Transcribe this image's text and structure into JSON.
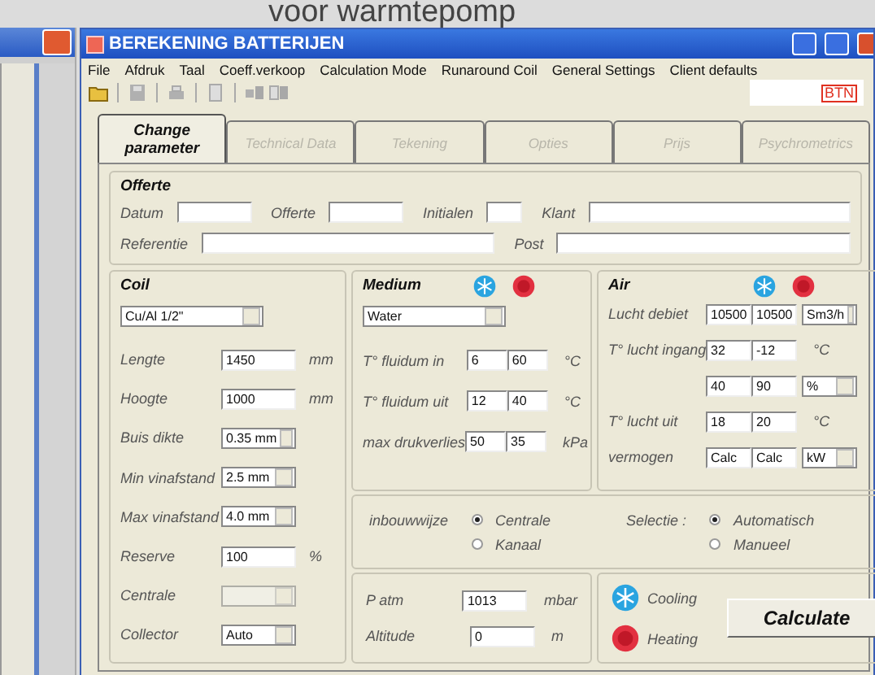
{
  "heading": "voor warmtepomp",
  "window": {
    "title": "BEREKENING BATTERIJEN",
    "logo": "BTN"
  },
  "menu": [
    "File",
    "Afdruk",
    "Taal",
    "Coeff.verkoop",
    "Calculation Mode",
    "Runaround Coil",
    "General Settings",
    "Client defaults"
  ],
  "tabs": [
    {
      "label": "Change parameter",
      "selected": true
    },
    {
      "label": "Technical Data",
      "selected": false
    },
    {
      "label": "Tekening",
      "selected": false
    },
    {
      "label": "Opties",
      "selected": false
    },
    {
      "label": "Prijs",
      "selected": false
    },
    {
      "label": "Psychrometrics",
      "selected": false
    }
  ],
  "offerte": {
    "title": "Offerte",
    "rows": [
      [
        {
          "label": "Datum"
        },
        {
          "label": "Offerte"
        },
        {
          "label": "Initialen"
        },
        {
          "label": "Klant"
        }
      ],
      [
        {
          "label": "Referentie"
        },
        {
          "label": "Post"
        }
      ]
    ]
  },
  "coil": {
    "title": "Coil",
    "type": "Cu/Al 1/2\"",
    "rows": [
      {
        "label": "Lengte",
        "kind": "input",
        "value": "1450",
        "unit": "mm",
        "disabled": false
      },
      {
        "label": "Hoogte",
        "kind": "input",
        "value": "1000",
        "unit": "mm",
        "disabled": false
      },
      {
        "label": "Buis dikte",
        "kind": "select",
        "value": "0.35 mm",
        "disabled": false
      },
      {
        "label": "Min vinafstand",
        "kind": "select",
        "value": "2.5 mm",
        "disabled": false
      },
      {
        "label": "Max vinafstand",
        "kind": "select",
        "value": "4.0 mm",
        "disabled": false
      },
      {
        "label": "Reserve",
        "kind": "input",
        "value": "100",
        "unit": "%",
        "disabled": false
      },
      {
        "label": "Centrale",
        "kind": "select",
        "disabled": true
      },
      {
        "label": "Collector",
        "kind": "select",
        "value": "Auto",
        "disabled": false
      }
    ]
  },
  "medium": {
    "title": "Medium",
    "type": "Water",
    "rows": [
      {
        "label": "T° fluidum in",
        "values": [
          "6",
          "60"
        ],
        "unit": "°C"
      },
      {
        "label": "T° fluidum uit",
        "values": [
          "12",
          "40"
        ],
        "unit": "°C"
      },
      {
        "label": "max drukverlies",
        "values": [
          "50",
          "35"
        ],
        "unit": "kPa"
      }
    ]
  },
  "air": {
    "title": "Air",
    "rows": [
      {
        "label": "Lucht debiet",
        "values": [
          "10500",
          "10500"
        ],
        "unit": "Sm3/h",
        "kind": "select"
      },
      {
        "label": "T° lucht ingang",
        "values": [
          "32",
          "-12"
        ],
        "unit": "°C",
        "kind": "text"
      },
      {
        "values": [
          "40",
          "90"
        ],
        "unit": "%",
        "kind": "select"
      },
      {
        "label": "T° lucht uit",
        "values": [
          "18",
          "20"
        ],
        "unit": "°C",
        "kind": "text"
      },
      {
        "label": "vermogen",
        "values": [
          "Calc",
          "Calc"
        ],
        "unit": "kW",
        "kind": "select"
      }
    ]
  },
  "options": [
    {
      "label": "inbouwwijze",
      "choices": [
        {
          "label": "Centrale",
          "selected": true
        },
        {
          "label": "Kanaal",
          "selected": false
        }
      ]
    },
    {
      "label": "Selectie :",
      "choices": [
        {
          "label": "Automatisch",
          "selected": true
        },
        {
          "label": "Manueel",
          "selected": false
        }
      ]
    }
  ],
  "atmosphere": [
    {
      "label": "P atm",
      "value": "1013",
      "unit": "mbar"
    },
    {
      "label": "Altitude",
      "value": "0",
      "unit": "m"
    }
  ],
  "legend": [
    {
      "kind": "cooling",
      "label": "Cooling"
    },
    {
      "kind": "heating",
      "label": "Heating"
    }
  ],
  "calculate": "Calculate"
}
